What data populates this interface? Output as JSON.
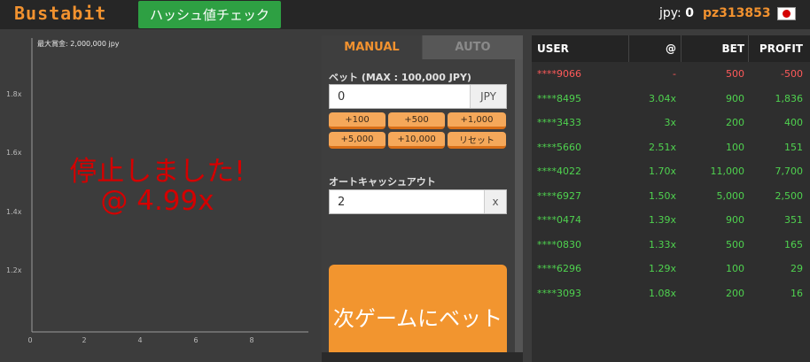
{
  "header": {
    "logo": "Bustabit",
    "hash_check_label": "ハッシュ値チェック",
    "currency_label": "jpy:",
    "balance": "0",
    "username": "pz313853",
    "flag_icon": "japan-flag-icon"
  },
  "chart": {
    "max_win_label": "最大賞金: 2,000,000 jpy",
    "crash_line1": "停止しました!",
    "crash_line2": "@ 4.99x",
    "y_ticks": [
      "1.8x",
      "1.6x",
      "1.4x",
      "1.2x"
    ],
    "x_ticks": [
      "0",
      "2",
      "4",
      "6",
      "8"
    ]
  },
  "controls": {
    "tab_manual": "MANUAL",
    "tab_auto": "AUTO",
    "bet_label": "ベット (MAX : 100,000 JPY)",
    "bet_value": "0",
    "bet_currency": "JPY",
    "chips": [
      "+100",
      "+500",
      "+1,000",
      "+5,000",
      "+10,000",
      "リセット"
    ],
    "cashout_label": "オートキャッシュアウト",
    "cashout_value": "2",
    "cashout_suffix": "x",
    "bet_button": "次ゲームにベット"
  },
  "table": {
    "headers": {
      "user": "USER",
      "at": "@",
      "bet": "BET",
      "profit": "PROFIT"
    },
    "rows": [
      {
        "user": "****9066",
        "at": "-",
        "bet": "500",
        "profit": "-500",
        "status": "lost"
      },
      {
        "user": "****8495",
        "at": "3.04x",
        "bet": "900",
        "profit": "1,836",
        "status": "won"
      },
      {
        "user": "****3433",
        "at": "3x",
        "bet": "200",
        "profit": "400",
        "status": "won"
      },
      {
        "user": "****5660",
        "at": "2.51x",
        "bet": "100",
        "profit": "151",
        "status": "won"
      },
      {
        "user": "****4022",
        "at": "1.70x",
        "bet": "11,000",
        "profit": "7,700",
        "status": "won"
      },
      {
        "user": "****6927",
        "at": "1.50x",
        "bet": "5,000",
        "profit": "2,500",
        "status": "won"
      },
      {
        "user": "****0474",
        "at": "1.39x",
        "bet": "900",
        "profit": "351",
        "status": "won"
      },
      {
        "user": "****0830",
        "at": "1.33x",
        "bet": "500",
        "profit": "165",
        "status": "won"
      },
      {
        "user": "****6296",
        "at": "1.29x",
        "bet": "100",
        "profit": "29",
        "status": "won"
      },
      {
        "user": "****3093",
        "at": "1.08x",
        "bet": "200",
        "profit": "16",
        "status": "won"
      }
    ]
  },
  "colors": {
    "accent": "#f2922f",
    "won": "#4fd24f",
    "lost": "#ff5a5a",
    "crash": "#d40000",
    "hash_button": "#2ea043"
  }
}
